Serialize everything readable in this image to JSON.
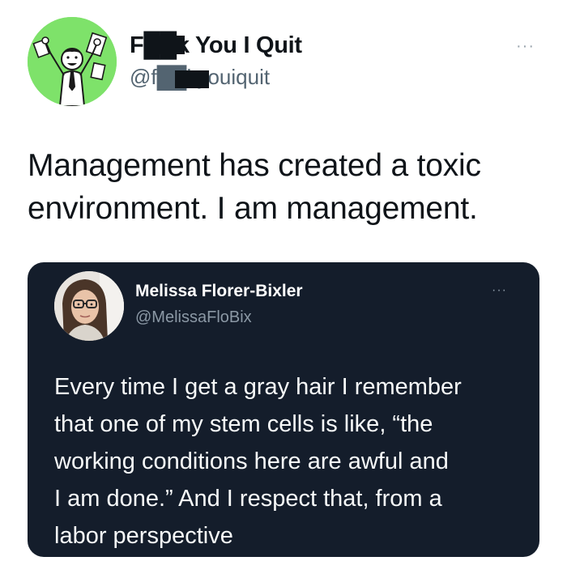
{
  "author": {
    "display_name": "F██k You I Quit",
    "handle": "@f██kyouiquit",
    "avatar_icon": "cartoon-man-throwing-papers-icon",
    "avatar_color": "#7ee26a"
  },
  "more_icon": "···",
  "tweet": {
    "lines": [
      "Management has created a toxic",
      "environment. I am management."
    ]
  },
  "quoted_tweet": {
    "display_name": "Melissa Florer-Bixler",
    "handle": "@MelissaFloBix",
    "more_icon": "···",
    "avatar_icon": "woman-with-glasses-photo",
    "background_color": "#141d2b",
    "lines": [
      "Every time I get a gray hair I remember",
      "that one of my stem cells is like, “the",
      "working conditions here are awful and",
      "I am done.” And I respect that, from a",
      "labor perspective"
    ]
  }
}
